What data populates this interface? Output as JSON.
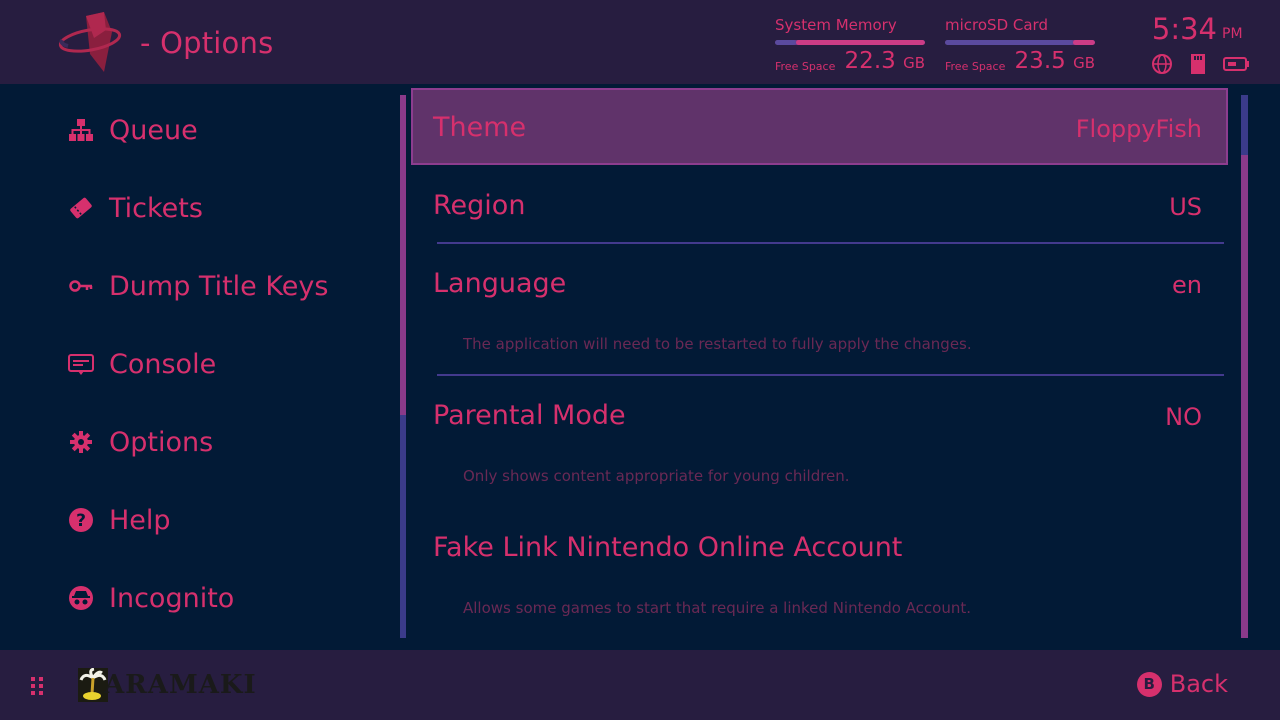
{
  "header": {
    "title": "- Options",
    "storage": [
      {
        "label": "System Memory",
        "free_label": "Free Space",
        "free_value": "22.3",
        "unit": "GB",
        "used_fraction": 0.14
      },
      {
        "label": "microSD Card",
        "free_label": "Free Space",
        "free_value": "23.5",
        "unit": "GB",
        "used_fraction": 0.85
      }
    ],
    "clock": {
      "time": "5:34",
      "ampm": "PM"
    },
    "status_icons": [
      "globe-icon",
      "sd-card-icon",
      "battery-icon"
    ]
  },
  "sidebar": {
    "items": [
      {
        "label": "Queue",
        "icon": "sitemap-icon"
      },
      {
        "label": "Tickets",
        "icon": "ticket-icon"
      },
      {
        "label": "Dump Title Keys",
        "icon": "key-icon"
      },
      {
        "label": "Console",
        "icon": "console-icon"
      },
      {
        "label": "Options",
        "icon": "gear-icon"
      },
      {
        "label": "Help",
        "icon": "help-icon"
      },
      {
        "label": "Incognito",
        "icon": "incognito-icon"
      }
    ]
  },
  "options": [
    {
      "label": "Theme",
      "value": "FloppyFish",
      "selected": true
    },
    {
      "label": "Region",
      "value": "US"
    },
    {
      "label": "Language",
      "value": "en",
      "description": "The application will need to be restarted to fully apply the changes."
    },
    {
      "label": "Parental Mode",
      "value": "NO",
      "description": "Only shows content appropriate for young children."
    },
    {
      "label": "Fake Link Nintendo Online Account",
      "value": "",
      "description": "Allows some games to start that require a linked Nintendo Account."
    }
  ],
  "footer": {
    "brand": "ARAMAKI",
    "back_button": "B",
    "back_label": "Back"
  },
  "colors": {
    "accent": "#d6306d",
    "background": "#021a36",
    "bar": "#271d40",
    "selected_row": "#60336a"
  }
}
